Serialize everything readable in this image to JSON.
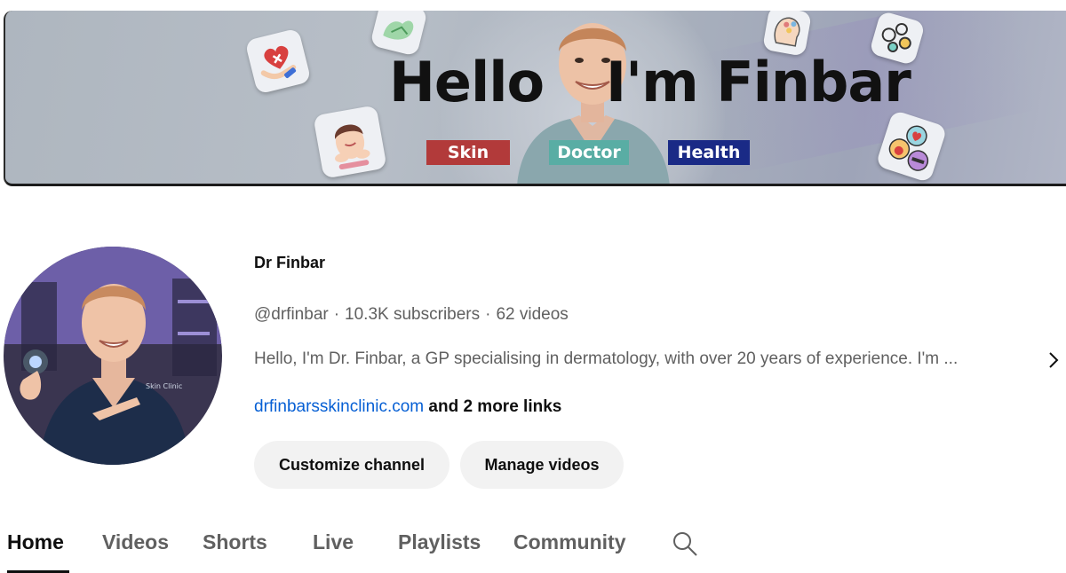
{
  "banner": {
    "title_left": "Hello",
    "title_right": "I'm Finbar",
    "tags": {
      "skin": "Skin",
      "doctor": "Doctor",
      "health": "Health"
    },
    "colors": {
      "skin": "#b23a3a",
      "doctor": "#59ada4",
      "health": "#1a2a86"
    }
  },
  "channel": {
    "name": "Dr Finbar",
    "handle": "@drfinbar",
    "separator": "·",
    "subscribers": "10.3K subscribers",
    "videos": "62 videos",
    "description": "Hello, I'm Dr. Finbar, a GP specialising in dermatology, with over 20 years of experience. I'm ...",
    "link": "drfinbarsskinclinic.com",
    "more_links": "and 2 more links"
  },
  "actions": {
    "customize": "Customize channel",
    "manage": "Manage videos"
  },
  "tabs": {
    "home": "Home",
    "videos": "Videos",
    "shorts": "Shorts",
    "live": "Live",
    "playlists": "Playlists",
    "community": "Community",
    "active": "Home"
  },
  "icons": {
    "description_expand": "chevron-right-icon",
    "tab_search": "search-icon"
  },
  "colors": {
    "link": "#065fd4",
    "secondary_text": "#606060",
    "button_bg": "#f2f2f2"
  }
}
